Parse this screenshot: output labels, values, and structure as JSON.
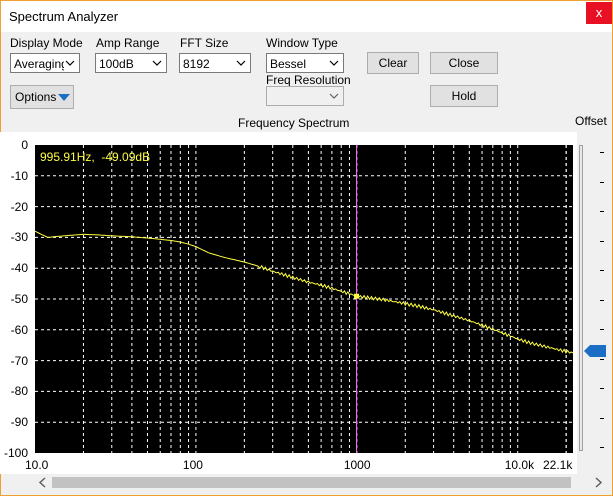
{
  "window": {
    "title": "Spectrum Analyzer",
    "close_glyph": "x"
  },
  "controls": {
    "display_mode": {
      "label": "Display Mode",
      "value": "Averaging"
    },
    "amp_range": {
      "label": "Amp Range",
      "value": "100dB"
    },
    "fft_size": {
      "label": "FFT Size",
      "value": "8192"
    },
    "window_type": {
      "label": "Window Type",
      "value": "Bessel"
    },
    "freq_resolution": {
      "label": "Freq Resolution",
      "value": ""
    },
    "clear_label": "Clear",
    "close_label": "Close",
    "hold_label": "Hold",
    "options_label": "Options"
  },
  "offset": {
    "label": "Offset",
    "level_db": -67
  },
  "readout": "995.91Hz,  -49.09dB",
  "chart_data": {
    "type": "line",
    "title": "Frequency Spectrum",
    "xscale": "log",
    "xlim": [
      10.0,
      22050
    ],
    "ylim": [
      -100,
      0
    ],
    "y_ticks": [
      "0",
      "-10",
      "-20",
      "-30",
      "-40",
      "-50",
      "-60",
      "-70",
      "-80",
      "-90",
      "-100"
    ],
    "x_ticks": [
      "10.0",
      "100",
      "1000",
      "10.0k",
      "22.1k"
    ],
    "grid": true,
    "background": "#000000",
    "line_color": "#ffff40",
    "cursor_color": "#ff66ff",
    "cursor": {
      "x": 995.91,
      "y": -49.09
    },
    "series": [
      {
        "x": [
          10,
          12,
          15,
          20,
          25,
          30,
          40,
          50,
          60,
          70,
          80,
          90,
          100,
          120,
          150,
          200,
          250,
          300,
          400,
          500,
          600,
          700,
          800,
          900,
          1000,
          1200,
          1500,
          2000,
          2500,
          3000,
          4000,
          5000,
          6000,
          7000,
          8000,
          9000,
          10000,
          12000,
          15000,
          18000,
          22050
        ],
        "y": [
          -28,
          -30,
          -29.5,
          -29,
          -29.2,
          -29.5,
          -29.8,
          -30.2,
          -30.6,
          -31,
          -31.5,
          -32.2,
          -33,
          -35,
          -36.5,
          -38,
          -39.5,
          -41,
          -43,
          -44.5,
          -45.5,
          -46.5,
          -47.5,
          -48.3,
          -49.1,
          -49.6,
          -50.3,
          -51.5,
          -52.5,
          -53.5,
          -55.5,
          -57,
          -58.5,
          -59.8,
          -61,
          -62,
          -63,
          -64.3,
          -65.5,
          -66.5,
          -67.5
        ]
      }
    ]
  }
}
